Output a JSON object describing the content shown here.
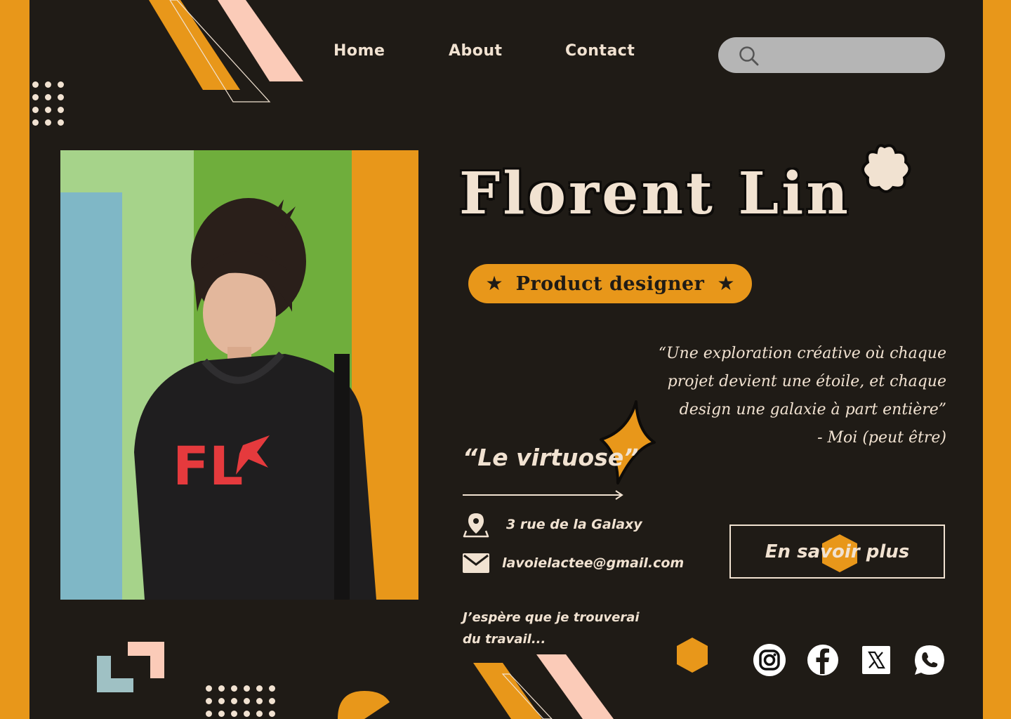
{
  "nav": {
    "items": [
      {
        "label": "Home"
      },
      {
        "label": "About"
      },
      {
        "label": "Contact"
      }
    ]
  },
  "search": {
    "placeholder": "",
    "icon": "search-icon"
  },
  "profile": {
    "name": "Florent Lin",
    "role": "Product designer",
    "role_star_left": "★",
    "role_star_right": "★",
    "photo_shirt_text": "FL"
  },
  "quote": {
    "lines": [
      "“Une exploration créative où chaque",
      "projet devient une étoile, et chaque",
      "design une galaxie à part entière”",
      "- Moi (peut être)"
    ]
  },
  "nickname": "“Le virtuose”",
  "contact": {
    "address": "3 rue de la Galaxy",
    "email": "lavoielactee@gmail.com"
  },
  "tagline": {
    "line1": "J’espère que je trouverai",
    "line2": "du travail..."
  },
  "cta": {
    "label": "En savoir plus"
  },
  "social": [
    {
      "icon": "instagram-icon"
    },
    {
      "icon": "facebook-icon"
    },
    {
      "icon": "x-icon"
    },
    {
      "icon": "whatsapp-icon"
    }
  ],
  "colors": {
    "background": "#1f1b16",
    "accent": "#e8971a",
    "cream": "#f1e2d1",
    "pink": "#fbcbb8",
    "blue": "#9fc1c4"
  }
}
